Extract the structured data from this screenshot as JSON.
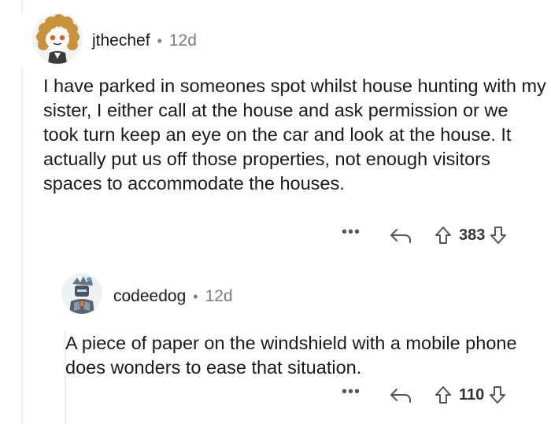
{
  "comment": {
    "username": "jthechef",
    "separator": "•",
    "age": "12d",
    "body": "I have parked in someones spot whilst house hunting with my sister, I either call at the house and ask permission or we took turn keep an eye on the car and look at the house. It actually put us off those properties, not enough visitors spaces to accommodate the houses.",
    "more_label": "•••",
    "score": "383"
  },
  "reply": {
    "username": "codeedog",
    "separator": "•",
    "age": "12d",
    "body": "A piece of paper on the windshield with a mobile phone does wonders to ease that situation.",
    "more_label": "•••",
    "score": "110"
  },
  "colors": {
    "text": "#1a1a1b",
    "meta": "#7c7c7c",
    "thread_line": "#edeff1",
    "avatar_curls": "#c8923c",
    "avatar_face": "#e8543a"
  },
  "icons": {
    "more": "more-dots-icon",
    "reply": "reply-arrow-icon",
    "upvote": "upvote-arrow-icon",
    "downvote": "downvote-arrow-icon"
  }
}
